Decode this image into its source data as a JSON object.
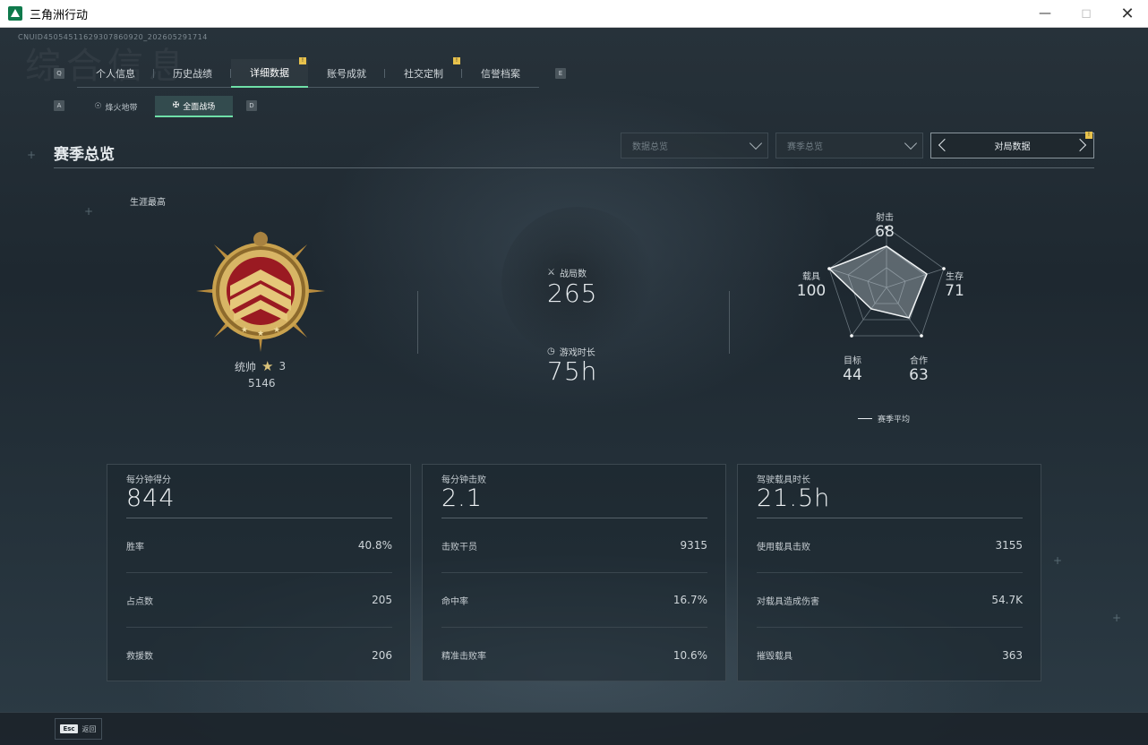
{
  "window": {
    "title": "三角洲行动"
  },
  "uid": "CNUID45054511629307860920_202605291714",
  "bg_title": "综合信息",
  "tabs": [
    {
      "label": "个人信息",
      "badge": ""
    },
    {
      "label": "历史战绩",
      "badge": ""
    },
    {
      "label": "详细数据",
      "badge": "!",
      "active": true
    },
    {
      "label": "账号成就",
      "badge": ""
    },
    {
      "label": "社交定制",
      "badge": "!"
    },
    {
      "label": "信誉档案",
      "badge": ""
    }
  ],
  "tab_keys": {
    "left": "Q",
    "right": "E"
  },
  "subtabs": [
    {
      "label": "烽火地带",
      "icon": "flame-icon"
    },
    {
      "label": "全面战场",
      "icon": "battlefield-icon",
      "active": true
    }
  ],
  "subtab_keys": {
    "left": "A",
    "right": "D"
  },
  "section_title": "赛季总览",
  "filters": {
    "data_overview": "数据总览",
    "season_overview": "赛季总览",
    "pager_label": "对局数据",
    "pager_badge": "!"
  },
  "career": {
    "label": "生涯最高",
    "rank_name": "统帅",
    "rank_stars": "3",
    "score": "5146"
  },
  "matches": {
    "label": "战局数",
    "value": "265"
  },
  "playtime": {
    "label": "游戏时长",
    "value": "75h"
  },
  "radar": {
    "axes": [
      {
        "label": "射击",
        "value": "68"
      },
      {
        "label": "生存",
        "value": "71"
      },
      {
        "label": "合作",
        "value": "63"
      },
      {
        "label": "目标",
        "value": "44"
      },
      {
        "label": "载具",
        "value": "100"
      }
    ],
    "legend": "赛季平均"
  },
  "cards": [
    {
      "title": "每分钟得分",
      "value": "844",
      "rows": [
        {
          "label": "胜率",
          "value": "40.8%"
        },
        {
          "label": "占点数",
          "value": "205"
        },
        {
          "label": "救援数",
          "value": "206"
        }
      ]
    },
    {
      "title": "每分钟击败",
      "value": "2.1",
      "rows": [
        {
          "label": "击败干员",
          "value": "9315"
        },
        {
          "label": "命中率",
          "value": "16.7%"
        },
        {
          "label": "精准击败率",
          "value": "10.6%"
        }
      ]
    },
    {
      "title": "驾驶载具时长",
      "value": "21.5h",
      "rows": [
        {
          "label": "使用载具击败",
          "value": "3155"
        },
        {
          "label": "对载具造成伤害",
          "value": "54.7K"
        },
        {
          "label": "摧毁载具",
          "value": "363"
        }
      ]
    }
  ],
  "bottom": {
    "esc_key": "Esc",
    "back_label": "返回"
  },
  "colors": {
    "accent": "#6fe0a8",
    "badge": "#e8c24c",
    "background": "#1e2830"
  }
}
